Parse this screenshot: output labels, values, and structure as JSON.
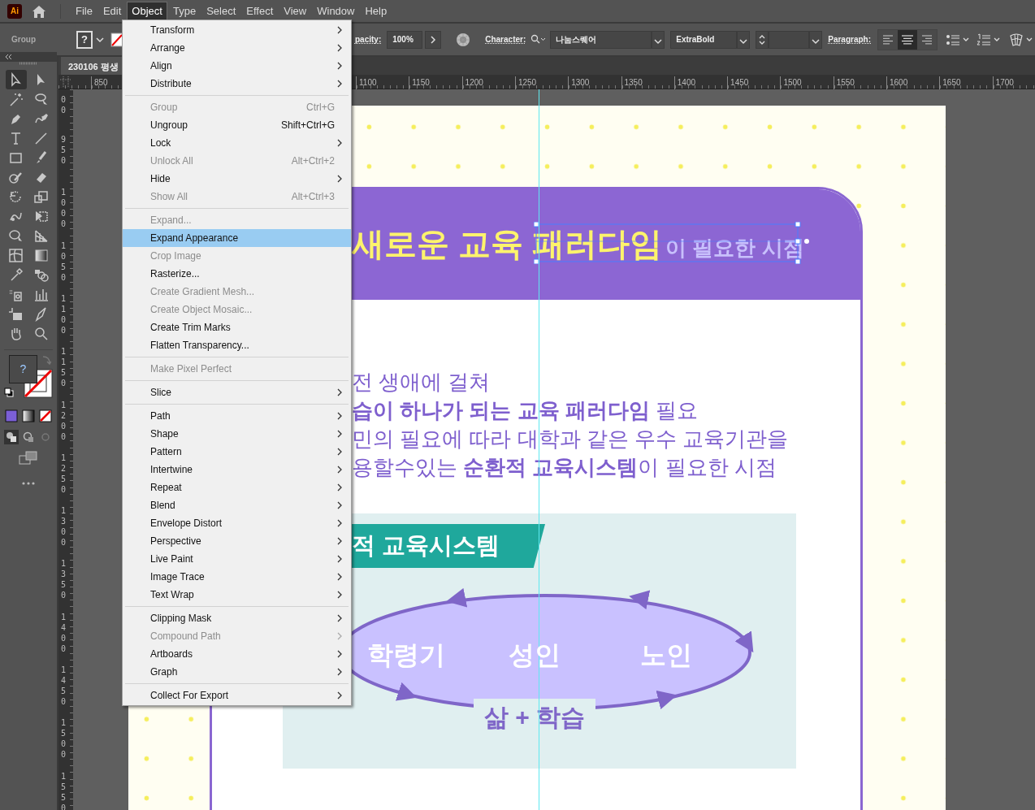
{
  "app_logo": "Ai",
  "menubar": {
    "items": [
      {
        "label": "File",
        "selected": false
      },
      {
        "label": "Edit",
        "selected": false
      },
      {
        "label": "Object",
        "selected": true
      },
      {
        "label": "Type",
        "selected": false
      },
      {
        "label": "Select",
        "selected": false
      },
      {
        "label": "Effect",
        "selected": false
      },
      {
        "label": "View",
        "selected": false
      },
      {
        "label": "Window",
        "selected": false
      },
      {
        "label": "Help",
        "selected": false
      }
    ]
  },
  "control_bar": {
    "selection_label": "Group",
    "fill_field": "?",
    "opacity_label": "pacity:",
    "opacity_value": "100%",
    "character_label": "Character:",
    "font_family": "나눔스퀘어",
    "font_style": "ExtraBold",
    "paragraph_label": "Paragraph:",
    "paragraph_alignments": [
      {
        "selected": false
      },
      {
        "selected": true
      },
      {
        "selected": false
      }
    ]
  },
  "document_tab": {
    "title": "230106 평생"
  },
  "toolbar": {
    "tools": [
      {
        "selected": true
      },
      {
        "selected": false
      },
      {
        "selected": false
      },
      {
        "selected": false
      },
      {
        "selected": false
      },
      {
        "selected": false
      },
      {
        "selected": false
      },
      {
        "selected": false
      },
      {
        "selected": false
      },
      {
        "selected": false
      },
      {
        "selected": false
      },
      {
        "selected": false
      },
      {
        "selected": false
      },
      {
        "selected": false
      },
      {
        "selected": false
      },
      {
        "selected": false
      },
      {
        "selected": false
      },
      {
        "selected": false
      },
      {
        "selected": false
      },
      {
        "selected": false
      },
      {
        "selected": false
      },
      {
        "selected": false
      },
      {
        "selected": false
      },
      {
        "selected": false
      },
      {
        "selected": false
      },
      {
        "selected": false
      },
      {
        "selected": false
      },
      {
        "selected": false
      }
    ],
    "fill_label": "?"
  },
  "rulers": {
    "horizontal": [
      "850",
      "1100",
      "1150",
      "1200",
      "1250",
      "1300",
      "1350",
      "1400",
      "1450",
      "1500",
      "1550",
      "1600",
      "1650",
      "1700"
    ],
    "vertical": [
      "00",
      "950",
      "1000",
      "1050",
      "1100",
      "1150",
      "1200",
      "1250",
      "1300",
      "1350",
      "1400",
      "1450",
      "1500",
      "1550"
    ]
  },
  "object_menu": {
    "sections": [
      [
        {
          "label": "Transform",
          "submenu": true,
          "disabled": false,
          "selected": false
        },
        {
          "label": "Arrange",
          "submenu": true,
          "disabled": false,
          "selected": false
        },
        {
          "label": "Align",
          "submenu": true,
          "disabled": false,
          "selected": false
        },
        {
          "label": "Distribute",
          "submenu": true,
          "disabled": false,
          "selected": false
        }
      ],
      [
        {
          "label": "Group",
          "shortcut": "Ctrl+G",
          "submenu": false,
          "disabled": true,
          "selected": false
        },
        {
          "label": "Ungroup",
          "shortcut": "Shift+Ctrl+G",
          "submenu": false,
          "disabled": false,
          "selected": false
        },
        {
          "label": "Lock",
          "submenu": true,
          "disabled": false,
          "selected": false
        },
        {
          "label": "Unlock All",
          "shortcut": "Alt+Ctrl+2",
          "submenu": false,
          "disabled": true,
          "selected": false
        },
        {
          "label": "Hide",
          "submenu": true,
          "disabled": false,
          "selected": false
        },
        {
          "label": "Show All",
          "shortcut": "Alt+Ctrl+3",
          "submenu": false,
          "disabled": true,
          "selected": false
        }
      ],
      [
        {
          "label": "Expand...",
          "submenu": false,
          "disabled": true,
          "selected": false
        },
        {
          "label": "Expand Appearance",
          "submenu": false,
          "disabled": false,
          "selected": true
        },
        {
          "label": "Crop Image",
          "submenu": false,
          "disabled": true,
          "selected": false
        },
        {
          "label": "Rasterize...",
          "submenu": false,
          "disabled": false,
          "selected": false
        },
        {
          "label": "Create Gradient Mesh...",
          "submenu": false,
          "disabled": true,
          "selected": false
        },
        {
          "label": "Create Object Mosaic...",
          "submenu": false,
          "disabled": true,
          "selected": false
        },
        {
          "label": "Create Trim Marks",
          "submenu": false,
          "disabled": false,
          "selected": false
        },
        {
          "label": "Flatten Transparency...",
          "submenu": false,
          "disabled": false,
          "selected": false
        }
      ],
      [
        {
          "label": "Make Pixel Perfect",
          "submenu": false,
          "disabled": true,
          "selected": false
        }
      ],
      [
        {
          "label": "Slice",
          "submenu": true,
          "disabled": false,
          "selected": false
        }
      ],
      [
        {
          "label": "Path",
          "submenu": true,
          "disabled": false,
          "selected": false
        },
        {
          "label": "Shape",
          "submenu": true,
          "disabled": false,
          "selected": false
        },
        {
          "label": "Pattern",
          "submenu": true,
          "disabled": false,
          "selected": false
        },
        {
          "label": "Intertwine",
          "submenu": true,
          "disabled": false,
          "selected": false
        },
        {
          "label": "Repeat",
          "submenu": true,
          "disabled": false,
          "selected": false
        },
        {
          "label": "Blend",
          "submenu": true,
          "disabled": false,
          "selected": false
        },
        {
          "label": "Envelope Distort",
          "submenu": true,
          "disabled": false,
          "selected": false
        },
        {
          "label": "Perspective",
          "submenu": true,
          "disabled": false,
          "selected": false
        },
        {
          "label": "Live Paint",
          "submenu": true,
          "disabled": false,
          "selected": false
        },
        {
          "label": "Image Trace",
          "submenu": true,
          "disabled": false,
          "selected": false
        },
        {
          "label": "Text Wrap",
          "submenu": true,
          "disabled": false,
          "selected": false
        }
      ],
      [
        {
          "label": "Clipping Mask",
          "submenu": true,
          "disabled": false,
          "selected": false
        },
        {
          "label": "Compound Path",
          "submenu": true,
          "disabled": true,
          "selected": false
        },
        {
          "label": "Artboards",
          "submenu": true,
          "disabled": false,
          "selected": false
        },
        {
          "label": "Graph",
          "submenu": true,
          "disabled": false,
          "selected": false
        }
      ],
      [
        {
          "label": "Collect For Export",
          "submenu": true,
          "disabled": false,
          "selected": false
        }
      ]
    ]
  },
  "artboard": {
    "title_highlight": "새로운 교육 패러다임",
    "title_rest": "이 필요한 시점",
    "paragraph": [
      "전 생애에 걸쳐",
      "**습이 하나가 되는 교육 패러다임** 필요",
      "민의 필요에 따라 대학과 같은 우수 교육기관을",
      "용할수있는 **순환적 교육시스템**이 필요한 시점"
    ],
    "banner": "적 교육시스템",
    "cycle_labels": [
      "학령기",
      "성인",
      "노인"
    ],
    "cycle_caption": "삶 + 학습"
  }
}
